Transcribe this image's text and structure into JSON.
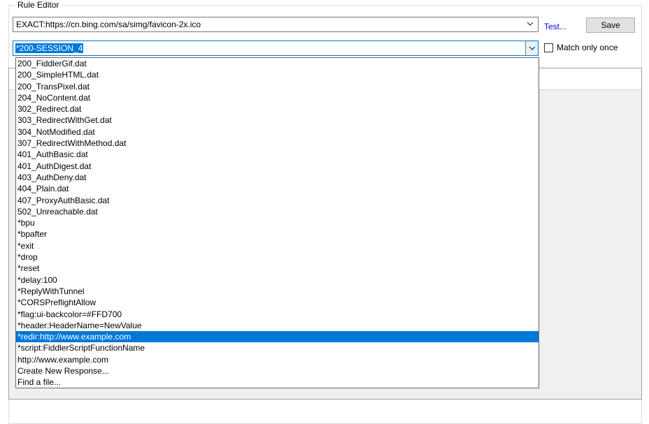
{
  "rule_editor": {
    "legend": "Rule Editor",
    "match_value": "EXACT:https://cn.bing.com/sa/simg/favicon-2x.ico",
    "action_value": "*200-SESSION_4",
    "test_link": "Test...",
    "save_label": "Save",
    "match_once_label": "Match only once",
    "match_once_checked": false
  },
  "dropdown": {
    "selected_index": 27,
    "items": [
      "200_FiddlerGif.dat",
      "200_SimpleHTML.dat",
      "200_TransPixel.dat",
      "204_NoContent.dat",
      "302_Redirect.dat",
      "303_RedirectWithGet.dat",
      "304_NotModified.dat",
      "307_RedirectWithMethod.dat",
      "401_AuthBasic.dat",
      "401_AuthDigest.dat",
      "403_AuthDeny.dat",
      "404_Plain.dat",
      "407_ProxyAuthBasic.dat",
      "502_Unreachable.dat",
      "*bpu",
      "*bpafter",
      "*exit",
      "*drop",
      "*reset",
      "*delay:100",
      "*ReplyWithTunnel",
      "*CORSPreflightAllow",
      "*flag:ui-backcolor=#FFD700",
      "*header:HeaderName=NewValue",
      "*redir:http://www.example.com",
      "*script:FiddlerScriptFunctionName",
      "http://www.example.com",
      "Create New Response...",
      "Find a file..."
    ]
  },
  "colors": {
    "accent": "#0078d7",
    "link": "#0000ee",
    "panel_bg": "#f0f0f0"
  },
  "icons": {
    "combo_arrow": "chevron-down-icon"
  }
}
